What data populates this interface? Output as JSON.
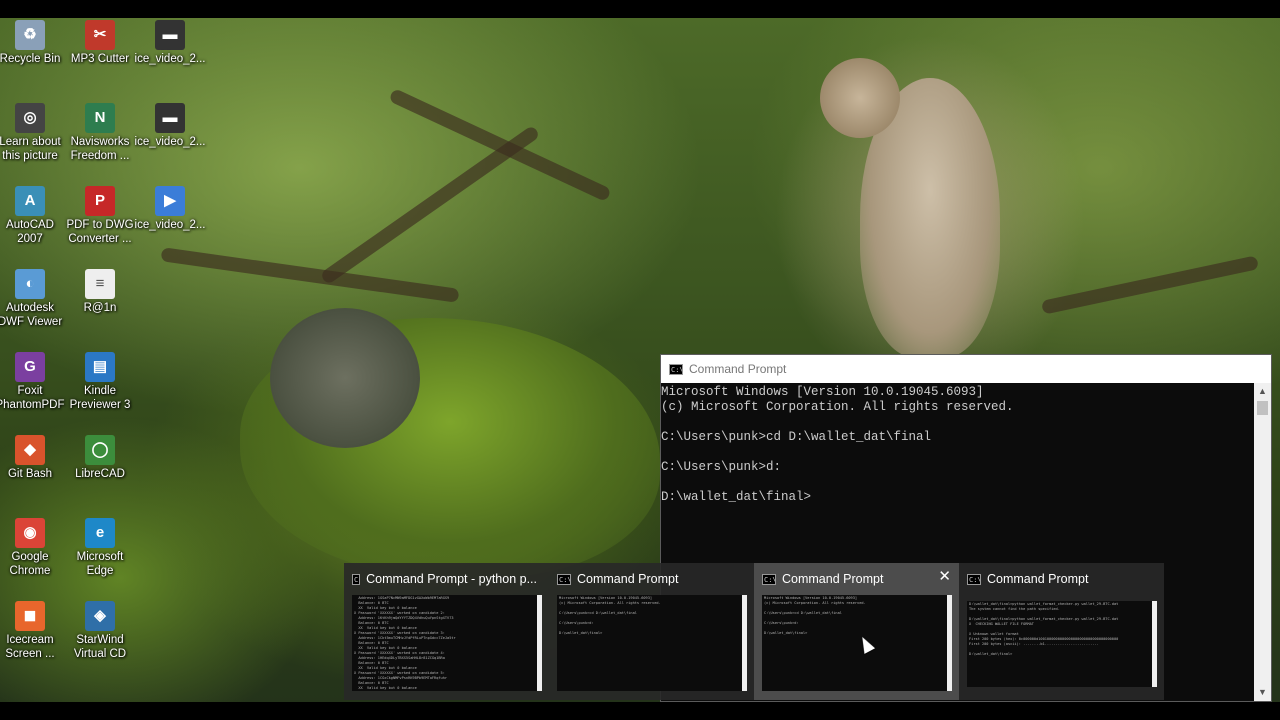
{
  "desktop": {
    "icons": [
      {
        "label": "Recycle Bin",
        "glyph": "♻",
        "color": "#8aa0b8"
      },
      {
        "label": "MP3 Cutter",
        "glyph": "✂",
        "color": "#c0392b"
      },
      {
        "label": "ice_video_2...",
        "glyph": "▬",
        "color": "#333333"
      },
      {
        "label": "Learn about\nthis picture",
        "glyph": "◎",
        "color": "#444444"
      },
      {
        "label": "Navisworks\nFreedom ...",
        "glyph": "N",
        "color": "#2e7d4f"
      },
      {
        "label": "ice_video_2...",
        "glyph": "▬",
        "color": "#333333"
      },
      {
        "label": "AutoCAD\n2007",
        "glyph": "A",
        "color": "#3a8fb7"
      },
      {
        "label": "PDF to DWG\nConverter ...",
        "glyph": "P",
        "color": "#c62828"
      },
      {
        "label": "ice_video_2...",
        "glyph": "▶",
        "color": "#3b7dd8"
      },
      {
        "label": "Autodesk\nDWF Viewer",
        "glyph": "◐",
        "color": "#5a9bd5"
      },
      {
        "label": "R@1n",
        "glyph": "≡",
        "color": "#eeeeee"
      },
      {
        "label": "Foxit\nPhantomPDF",
        "glyph": "G",
        "color": "#7b3fa0"
      },
      {
        "label": "Kindle\nPreviewer 3",
        "glyph": "▤",
        "color": "#2b78c5"
      },
      {
        "label": "Git Bash",
        "glyph": "◆",
        "color": "#d9532c"
      },
      {
        "label": "LibreCAD",
        "glyph": "◯",
        "color": "#3c8d3c"
      },
      {
        "label": "Google\nChrome",
        "glyph": "◉",
        "color": "#db4437"
      },
      {
        "label": "Microsoft\nEdge",
        "glyph": "e",
        "color": "#1e88c8"
      },
      {
        "label": "Icecream\nScreen ...",
        "glyph": "◼",
        "color": "#e8662c"
      },
      {
        "label": "StarWind\nVirtual CD",
        "glyph": "◈",
        "color": "#2f6fa8"
      }
    ]
  },
  "cmd": {
    "title": "Command Prompt",
    "icon_text": "C:\\",
    "output": "Microsoft Windows [Version 10.0.19045.6093]\n(c) Microsoft Corporation. All rights reserved.\n\nC:\\Users\\punk>cd D:\\wallet_dat\\final\n\nC:\\Users\\punk>d:\n\nD:\\wallet_dat\\final>",
    "scroll_up": "▲",
    "scroll_down": "▼"
  },
  "thumbnails": [
    {
      "title": "Command Prompt - python p...",
      "preview": "  Address: 1GSaP7NcMN9aMFDG1vGAXoWb9EMTaRGS9\n  Balance: 0 BTC\n  XX  Valid key but 0 balance\nX Password 'XXXXXX' worked on candidate 2:\n  Address: 1KtKh9jmQdYYYTZDQ4VdhuQuYpnStgXTV73\n  Balance: 0 BTC\n  XX  Valid key but 0 balance\nX Password 'XXXXXX' worked on candidate 3:\n  Address: 1Ckt5muTCMHzJYdPfRLuPTnpGdcc7ZeJa5tr\n  Balance: 0 BTC\n  XX  Valid key but 0 balance\nX Password 'XXXXXX' worked on candidate 4:\n  Address: 1HEdq4DLyTBXS5SaHHL8r81ZCGq1BRa\n  Balance: 0 BTC\n  XX  Valid key but 0 balance\nX Password 'XXXXXX' worked on candidate 5:\n  Address: 1CGxCkgNMFvPsnRK9BPb9EMTaFRqfuhr\n  Balance: 0 BTC\n  XX  Valid key but 0 balance"
    },
    {
      "title": "Command Prompt",
      "preview": "Microsoft Windows [Version 10.0.19045.6093]\n(c) Microsoft Corporation. All rights reserved.\n\nC:\\Users\\punk>cd D:\\wallet_dat\\final\n\nC:\\Users\\punk>d:\n\nD:\\wallet_dat\\final>"
    },
    {
      "title": "Command Prompt",
      "close": "✕",
      "preview": "Microsoft Windows [Version 10.0.19045.6093]\n(c) Microsoft Corporation. All rights reserved.\n\nC:\\Users\\punk>cd D:\\wallet_dat\\final\n\nC:\\Users\\punk>d:\n\nD:\\wallet_dat\\final>"
    },
    {
      "title": "Command Prompt",
      "preview": "D:\\wallet_dat\\final>python wallet_format_checker.py wallet_29-BTC.dat\nThe system cannot find the path specified.\n\nD:\\wallet_dat\\final>python wallet_format_checker.py wallet_29-BTC.dat\nX  CHECKING WALLET FILE FORMAT\n\nX Unknown wallet format\nFirst 200 bytes (hex): 0c000000d1001000000000000000000000000000000000\nFirst 200 bytes (ascii): ........b1.........................\n\nD:\\wallet_dat\\final>"
    }
  ]
}
